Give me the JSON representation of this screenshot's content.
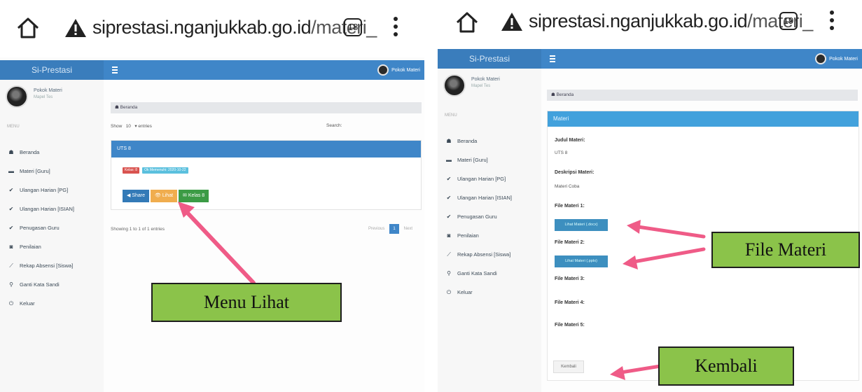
{
  "panels": [
    {
      "browser": {
        "url_host": "siprestasi.nganjukkab.go.id",
        "url_path": "/materi_",
        "tab_count": "18"
      },
      "app": {
        "brand": "Si-Prestasi",
        "top_user": "Pokok Materi"
      },
      "sidebar": {
        "user_name": "Pokok Materi",
        "user_role": "Mapel Tes",
        "menu_title": "MENU",
        "items": [
          {
            "icon": "☗",
            "label": "Beranda"
          },
          {
            "icon": "▬",
            "label": "Materi [Guru]"
          },
          {
            "icon": "✔",
            "label": "Ulangan Harian [PG]"
          },
          {
            "icon": "✔",
            "label": "Ulangan Harian [ISIAN]"
          },
          {
            "icon": "✔",
            "label": "Penugasan Guru"
          },
          {
            "icon": "◙",
            "label": "Penilaian"
          },
          {
            "icon": "⟋",
            "label": "Rekap Absensi [Siswa]"
          },
          {
            "icon": "⚲",
            "label": "Ganti Kata Sandi"
          },
          {
            "icon": "⏻",
            "label": "Keluar"
          }
        ]
      },
      "content": {
        "breadcrumb": "☗ Beranda",
        "show_label": "Show",
        "show_value": "10",
        "entries_label": "▾ entries",
        "search_label": "Search:",
        "card_title": "UTS 8",
        "label_red": "Kelas: 8",
        "label_blue": "Ok Memenuhi: 2020-10-22",
        "buttons": {
          "share": "◀ Share",
          "lihat": "👁 Lihat",
          "kelas": "✉ Kelas 8"
        },
        "showing": "Showing 1 to 1 of 1 entries",
        "pager": {
          "prev": "Previous",
          "page": "1",
          "next": "Next"
        }
      },
      "annotation": "Menu Lihat"
    },
    {
      "browser": {
        "url_host": "siprestasi.nganjukkab.go.id",
        "url_path": "/materi_",
        "tab_count": "19"
      },
      "app": {
        "brand": "Si-Prestasi",
        "top_user": "Pokok Materi"
      },
      "sidebar": {
        "user_name": "Pokok Materi",
        "user_role": "Mapel Tes",
        "menu_title": "MENU",
        "items": [
          {
            "icon": "☗",
            "label": "Beranda"
          },
          {
            "icon": "▬",
            "label": "Materi [Guru]"
          },
          {
            "icon": "✔",
            "label": "Ulangan Harian [PG]"
          },
          {
            "icon": "✔",
            "label": "Ulangan Harian [ISIAN]"
          },
          {
            "icon": "✔",
            "label": "Penugasan Guru"
          },
          {
            "icon": "◙",
            "label": "Penilaian"
          },
          {
            "icon": "⟋",
            "label": "Rekap Absensi [Siswa]"
          },
          {
            "icon": "⚲",
            "label": "Ganti Kata Sandi"
          },
          {
            "icon": "⏻",
            "label": "Keluar"
          }
        ]
      },
      "content": {
        "breadcrumb": "☗ Beranda",
        "panel_title": "Materi",
        "judul_label": "Judul Materi:",
        "judul_value": "UTS 8",
        "deskripsi_label": "Deskripsi Materi:",
        "deskripsi_value": "Materi Coba",
        "file1_label": "File Materi 1:",
        "file1_button": "Lihat Materi (.docx)",
        "file2_label": "File Materi 2:",
        "file2_button": "Lihat Materi (.pptx)",
        "file3_label": "File Materi 3:",
        "file4_label": "File Materi 4:",
        "file5_label": "File Materi 5:",
        "back_button": "Kembali"
      },
      "annotations": {
        "file": "File Materi",
        "back": "Kembali"
      }
    }
  ],
  "colors": {
    "header_blue": "#3f86c8",
    "annotation_green": "#8bc34a",
    "arrow_pink": "#ef5b87"
  }
}
